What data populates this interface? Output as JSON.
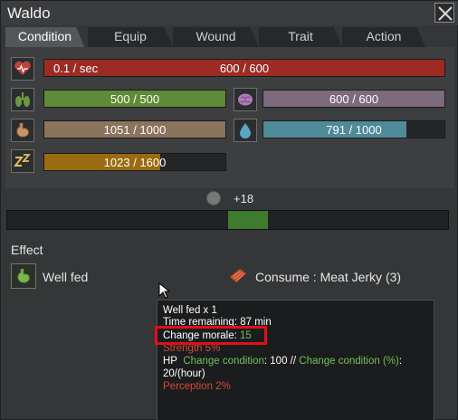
{
  "window": {
    "title": "Waldo"
  },
  "tabs": [
    {
      "label": "Condition",
      "active": true
    },
    {
      "label": "Equip"
    },
    {
      "label": "Wound"
    },
    {
      "label": "Trait"
    },
    {
      "label": "Action"
    }
  ],
  "stats": {
    "health": {
      "rate": "0.1 / sec",
      "text": "600 / 600",
      "fill": 1.0,
      "color": "#9b2b23",
      "icon": "heart-icon"
    },
    "stamina": {
      "text": "500 / 500",
      "fill": 1.0,
      "color": "#5f8a37",
      "icon": "lungs-icon"
    },
    "mind": {
      "text": "600 / 600",
      "fill": 1.0,
      "color": "#7d6a7d",
      "icon": "brain-icon"
    },
    "food": {
      "text": "1051 / 1000",
      "fill": 1.0,
      "color": "#8c735c",
      "icon": "stomach-icon"
    },
    "water": {
      "text": "791 / 1000",
      "fill": 0.791,
      "color": "#4f8a99",
      "icon": "water-drop-icon"
    },
    "sleep": {
      "text": "1023 / 1600",
      "fill": 0.639,
      "color": "#9a6b10",
      "icon": "sleep-icon"
    }
  },
  "morale": {
    "value": "+18"
  },
  "effects": {
    "heading": "Effect",
    "item_name": "Well fed",
    "consume_text": "Consume : Meat Jerky (3)"
  },
  "tooltip": {
    "line1": "Well fed x 1",
    "line2": "Time remaining: 87 min",
    "morale_label": "Change morale:",
    "morale_value": "15",
    "strength": "Strength 5%",
    "hp_label": "HP",
    "change_condition": "Change condition",
    "hp_value": ": 100 //",
    "change_condition_pct": "Change condition (%)",
    "colon": ":",
    "hp_rate": "20/(hour)",
    "perception": "Perception 2%"
  }
}
